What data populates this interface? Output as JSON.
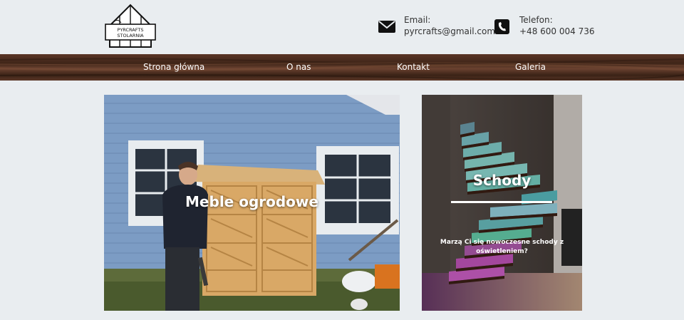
{
  "header": {
    "logo_text_line1": "PYRCRAFTS",
    "logo_text_line2": "STOLARNIA",
    "email_label": "Email:",
    "email_value": "pyrcrafts@gmail.com",
    "phone_label": "Telefon:",
    "phone_value": "+48 600 004 736"
  },
  "nav": {
    "items": [
      {
        "label": "Strona główna"
      },
      {
        "label": "O nas"
      },
      {
        "label": "Kontakt"
      },
      {
        "label": "Galeria"
      }
    ]
  },
  "cards": [
    {
      "title": "Meble ogrodowe"
    },
    {
      "title": "Schody",
      "description": "Marzą Ci się nowoczesne schody z oświetleniem?"
    }
  ],
  "icons": {
    "email": "envelope-icon",
    "phone": "phone-icon"
  }
}
